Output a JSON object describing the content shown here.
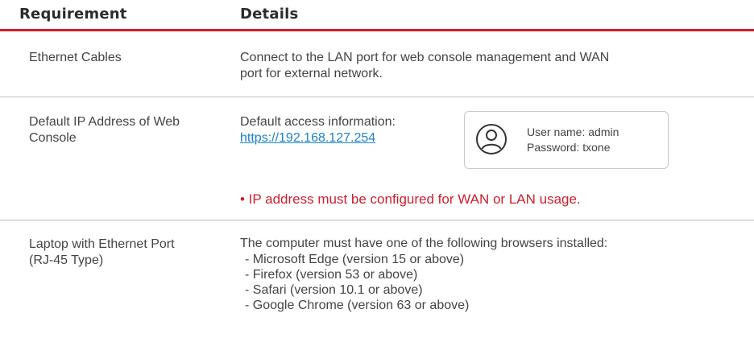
{
  "table": {
    "headers": [
      "Requirement",
      "Details"
    ],
    "rows": [
      {
        "requirement": "Ethernet Cables",
        "details": "Connect to the LAN port for web console management and WAN port for external network."
      },
      {
        "requirement": "Default IP Address of Web Console",
        "details_intro": "Default access information:",
        "url": "https://192.168.127.254",
        "card": {
          "icon": "user-circle-icon",
          "username_line": "User name: admin",
          "password_line": "Password: txone"
        },
        "note": "• IP address must be configured for WAN or LAN usage."
      },
      {
        "requirement": "Laptop with Ethernet Port (RJ-45 Type)",
        "details_intro": "The computer must have one of the following browsers installed:",
        "browsers": [
          "- Microsoft Edge (version 15 or above)",
          "- Firefox (version 53 or above)",
          "- Safari (version 10.1 or above)",
          "- Google Chrome (version 63 or above)"
        ]
      }
    ]
  },
  "colors": {
    "accent": "#cc1f2d",
    "link": "#1a82c4",
    "divider": "#bdbdbd"
  }
}
